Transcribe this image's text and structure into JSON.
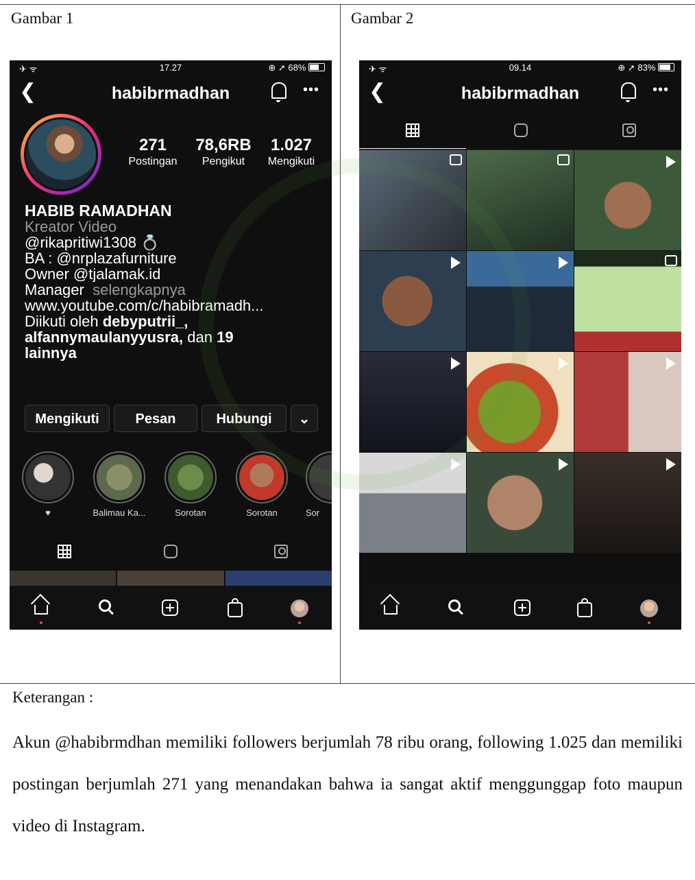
{
  "figure1": {
    "label": "Gambar 1",
    "status": {
      "left": "✈ ᯤ",
      "time": "17.27",
      "battery": "⊕ ➚ 68%",
      "battery_level": 0.68
    },
    "username": "habibrmadhan",
    "stats": [
      {
        "value": "271",
        "label": "Postingan"
      },
      {
        "value": "78,6RB",
        "label": "Pengikut"
      },
      {
        "value": "1.027",
        "label": "Mengikuti"
      }
    ],
    "bio": {
      "name": "HABIB RAMADHAN",
      "category": "Kreator Video",
      "line1": "@rikapritiwi1308 💍",
      "line2": "BA : @nrplazafurniture",
      "line3": "Owner @tjalamak.id",
      "line4a": "Manager",
      "line4b": "selengkapnya",
      "link": "www.youtube.com/c/habibramadh...",
      "followed_prefix": "Diikuti oleh",
      "followed_user1": "debyputrii_,",
      "followed_user2": "alfannymaulanyyusra,",
      "followed_mid": "dan",
      "followed_count": "19",
      "followed_suffix": "lainnya"
    },
    "buttons": {
      "follow": "Mengikuti",
      "message": "Pesan",
      "contact": "Hubungi",
      "more": "⌄"
    },
    "highlights": [
      "♥",
      "Balimau Ka...",
      "Sorotan",
      "Sorotan",
      "Sor"
    ]
  },
  "figure2": {
    "label": "Gambar 2",
    "status": {
      "left": "✈ ᯤ",
      "time": "09.14",
      "battery": "⊕ ➚ 83%",
      "battery_level": 0.83
    },
    "username": "habibrmadhan"
  },
  "colors": {
    "screen_bg": "#0f0f0f",
    "story_ring": "#ee2a7b",
    "nav_dot": "#ff3b5c"
  },
  "caption": {
    "title": "Keterangan :",
    "body": "Akun @habibrmdhan memiliki followers berjumlah 78 ribu orang, following 1.025 dan memiliki postingan berjumlah 271 yang menandakan bahwa ia sangat aktif menggunggap foto maupun video di Instagram."
  }
}
